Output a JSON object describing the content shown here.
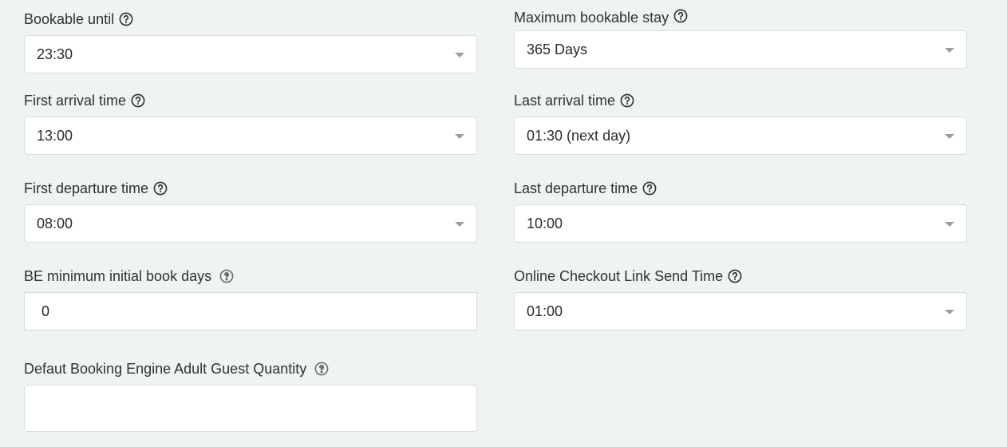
{
  "fields": {
    "bookable_until": {
      "label": "Bookable until",
      "value": "23:30"
    },
    "maximum_bookable_stay": {
      "label": "Maximum bookable stay",
      "value": "365 Days"
    },
    "first_arrival_time": {
      "label": "First arrival time",
      "value": "13:00"
    },
    "last_arrival_time": {
      "label": "Last arrival time",
      "value": "01:30 (next day)"
    },
    "first_departure_time": {
      "label": "First departure time",
      "value": "08:00"
    },
    "last_departure_time": {
      "label": "Last departure time",
      "value": "10:00"
    },
    "be_minimum_initial_book_days": {
      "label": "BE minimum initial book days",
      "value": "0"
    },
    "online_checkout_link_send_time": {
      "label": "Online Checkout Link Send Time",
      "value": "01:00"
    },
    "default_adult_guest_quantity": {
      "label": "Defaut Booking Engine Adult Guest Quantity",
      "value": ""
    }
  },
  "icons": {
    "help": "question-circle-icon",
    "dropdown": "caret-down-icon"
  },
  "colors": {
    "background": "#eff4f3",
    "input_background": "#ffffff",
    "input_border": "#d9dddf",
    "text": "#2b2b2b",
    "caret": "#9a9ea2"
  }
}
